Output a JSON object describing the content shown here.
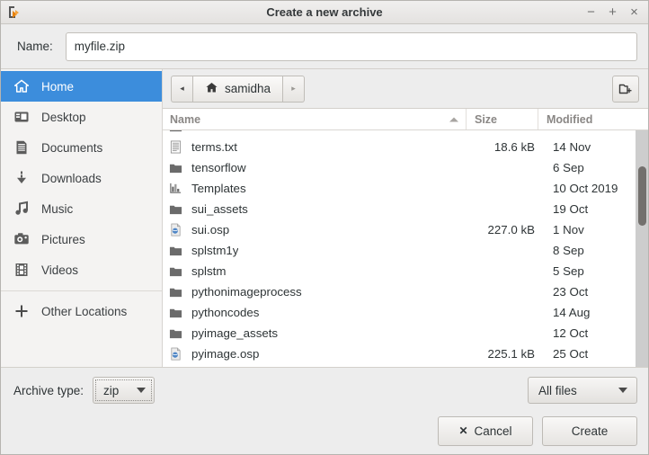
{
  "window": {
    "title": "Create a new archive",
    "app_icon": "archive-manager-icon",
    "controls": {
      "minimize": "−",
      "maximize": "+",
      "close": "×"
    }
  },
  "name_field": {
    "label": "Name:",
    "value": "myfile.zip",
    "placeholder": ""
  },
  "sidebar": {
    "items": [
      {
        "label": "Home",
        "icon": "home-icon",
        "selected": true
      },
      {
        "label": "Desktop",
        "icon": "desktop-icon",
        "selected": false
      },
      {
        "label": "Documents",
        "icon": "documents-icon",
        "selected": false
      },
      {
        "label": "Downloads",
        "icon": "downloads-icon",
        "selected": false
      },
      {
        "label": "Music",
        "icon": "music-icon",
        "selected": false
      },
      {
        "label": "Pictures",
        "icon": "pictures-icon",
        "selected": false
      },
      {
        "label": "Videos",
        "icon": "videos-icon",
        "selected": false
      }
    ],
    "other": {
      "label": "Other Locations",
      "icon": "plus-icon"
    }
  },
  "pathbar": {
    "back": "◂",
    "forward": "▸",
    "current": "samidha",
    "current_icon": "home-icon",
    "new_folder_icon": "create-folder-icon"
  },
  "columns": {
    "name": "Name",
    "size": "Size",
    "modified": "Modified",
    "sort": "ascending"
  },
  "files": [
    {
      "name": "terms.txt",
      "size": "18.6 kB",
      "modified": "14 Nov",
      "icon": "text-file-icon"
    },
    {
      "name": "tensorflow",
      "size": "",
      "modified": "6 Sep",
      "icon": "folder-icon"
    },
    {
      "name": "Templates",
      "size": "",
      "modified": "10 Oct 2019",
      "icon": "templates-folder-icon"
    },
    {
      "name": "sui_assets",
      "size": "",
      "modified": "19 Oct",
      "icon": "folder-icon"
    },
    {
      "name": "sui.osp",
      "size": "227.0 kB",
      "modified": "1 Nov",
      "icon": "osp-file-icon"
    },
    {
      "name": "splstm1y",
      "size": "",
      "modified": "8 Sep",
      "icon": "folder-icon"
    },
    {
      "name": "splstm",
      "size": "",
      "modified": "5 Sep",
      "icon": "folder-icon"
    },
    {
      "name": "pythonimageprocess",
      "size": "",
      "modified": "23 Oct",
      "icon": "folder-icon"
    },
    {
      "name": "pythoncodes",
      "size": "",
      "modified": "14 Aug",
      "icon": "folder-icon"
    },
    {
      "name": "pyimage_assets",
      "size": "",
      "modified": "12 Oct",
      "icon": "folder-icon"
    },
    {
      "name": "pyimage.osp",
      "size": "225.1 kB",
      "modified": "25 Oct",
      "icon": "osp-file-icon"
    }
  ],
  "footer": {
    "archive_type_label": "Archive type:",
    "archive_type_value": "zip",
    "filter_value": "All files",
    "cancel_label": "Cancel",
    "create_label": "Create"
  },
  "colors": {
    "selection": "#3c8ddc",
    "window_bg": "#ededed",
    "list_bg": "#ffffff",
    "folder_icon": "#6b6b6b"
  }
}
